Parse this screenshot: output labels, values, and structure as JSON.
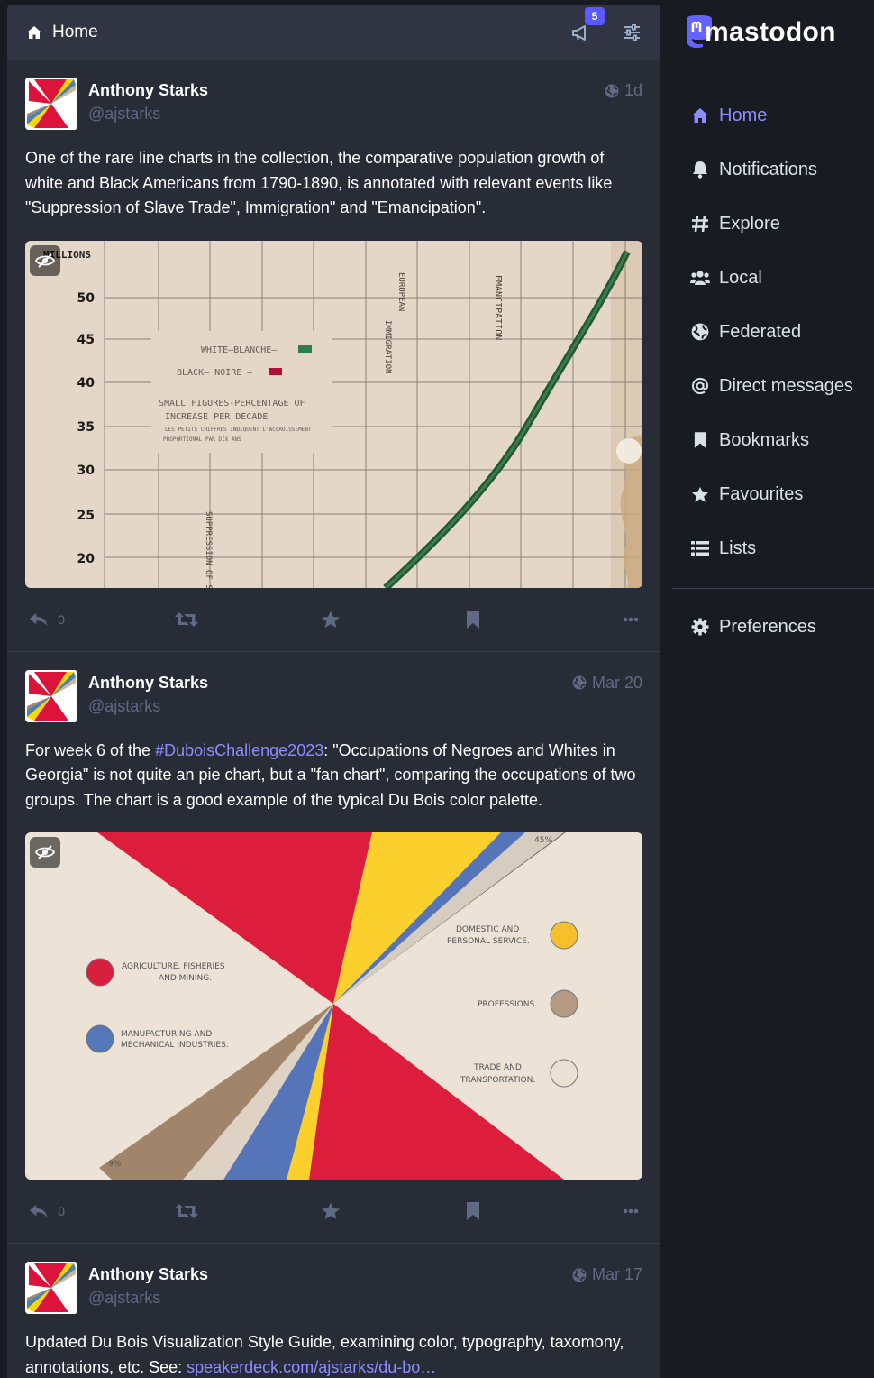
{
  "header": {
    "title": "Home",
    "announcements_badge": "5"
  },
  "brand": {
    "name": "mastodon",
    "accent": "#595aff"
  },
  "sidebar": {
    "items": [
      {
        "label": "Home",
        "icon": "home-icon"
      },
      {
        "label": "Notifications",
        "icon": "bell-icon"
      },
      {
        "label": "Explore",
        "icon": "hashtag-icon"
      },
      {
        "label": "Local",
        "icon": "users-icon"
      },
      {
        "label": "Federated",
        "icon": "globe-icon"
      },
      {
        "label": "Direct messages",
        "icon": "at-icon"
      },
      {
        "label": "Bookmarks",
        "icon": "bookmark-icon"
      },
      {
        "label": "Favourites",
        "icon": "star-icon"
      },
      {
        "label": "Lists",
        "icon": "list-icon"
      }
    ],
    "preferences": {
      "label": "Preferences",
      "icon": "gear-icon"
    }
  },
  "posts": [
    {
      "display_name": "Anthony Starks",
      "acct": "@ajstarks",
      "time": "1d",
      "text": "One of the rare line charts in the collection, the comparative population growth of white and Black Americans from 1790-1890, is annotated with relevant events like \"Suppression of Slave Trade\", Immigration\" and  \"Emancipation\".",
      "replies": "0",
      "media": {
        "title": "MILLIONS",
        "y_ticks": [
          "50",
          "45",
          "40",
          "35",
          "30",
          "25",
          "20"
        ],
        "legend_white": "WHITE—BLANCHE—",
        "legend_black": "BLACK— NOIRE —",
        "note1": "SMALL FIGURES-PERCENTAGE OF",
        "note2": "INCREASE PER DECADE",
        "note3": "LES PETITS CHIFFRES INDIQUENT L'ACCROISSEMENT",
        "note4": "PROPORTIONAL PAR DIX ANS",
        "annot_immigration1": "EUROPEAN",
        "annot_immigration2": "IMMIGRATION",
        "annot_emancipation": "EMANCIPATION",
        "annot_suppression": "SUPPRESSION OF S"
      }
    },
    {
      "display_name": "Anthony Starks",
      "acct": "@ajstarks",
      "time": "Mar 20",
      "text_before": "For week 6 of the ",
      "hashtag": "#DuboisChallenge2023",
      "text_after": ": \"Occupations of Negroes and Whites in Georgia\" is not quite an pie chart, but a \"fan chart\", comparing the occupations of two groups. The chart is a good example of the typical Du Bois color palette.",
      "replies": "0",
      "media": {
        "top_pct": "45%",
        "bottom_pct": "9%",
        "agri1": "AGRICULTURE, FISHERIES",
        "agri2": "AND MINING.",
        "manu1": "MANUFACTURING AND",
        "manu2": "MECHANICAL INDUSTRIES.",
        "dom1": "DOMESTIC AND",
        "dom2": "PERSONAL SERVICE.",
        "prof": "PROFESSIONS.",
        "trade1": "TRADE AND",
        "trade2": "TRANSPORTATION."
      }
    },
    {
      "display_name": "Anthony Starks",
      "acct": "@ajstarks",
      "time": "Mar 17",
      "text": "Updated Du Bois Visualization Style Guide, examining color, typography, taxomony, annotations, etc.  See: ",
      "link": "speakerdeck.com/ajstarks/du-bo…"
    }
  ]
}
